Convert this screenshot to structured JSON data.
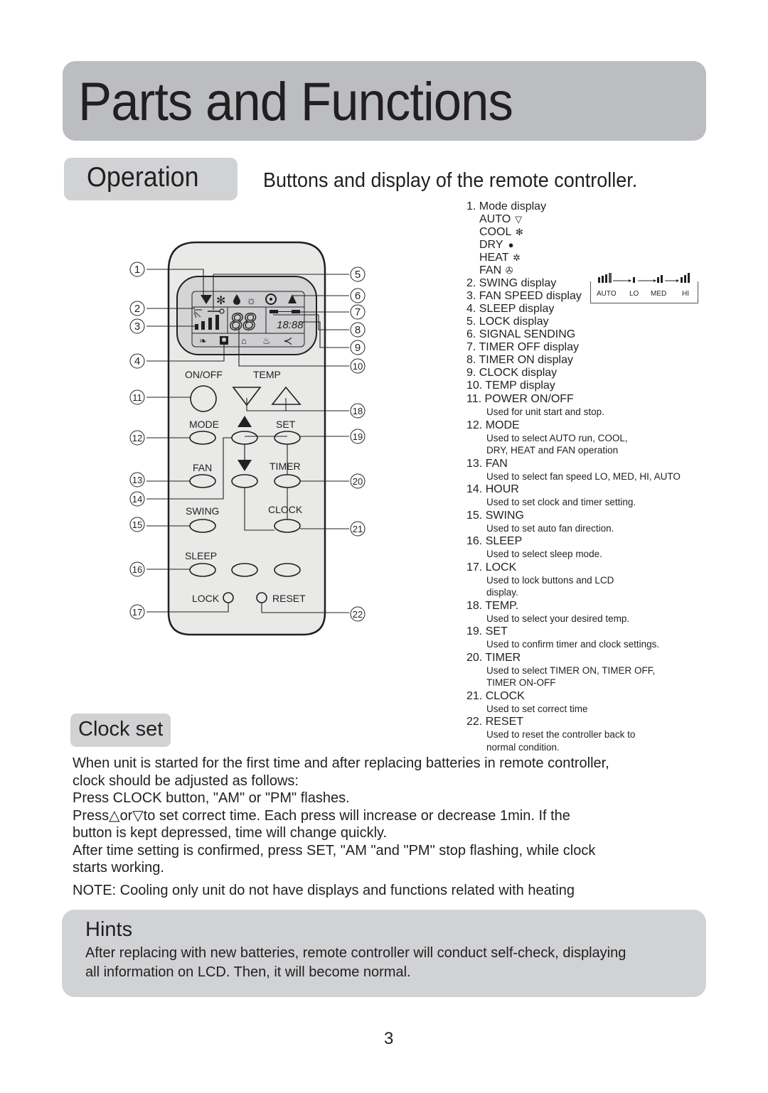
{
  "header": {
    "title": "Parts and Functions"
  },
  "operation": {
    "label": "Operation",
    "subtitle": "Buttons and display of the remote controller."
  },
  "remote": {
    "labels": {
      "onoff": "ON/OFF",
      "temp": "TEMP",
      "mode": "MODE",
      "set": "SET",
      "fan": "FAN",
      "timer": "TIMER",
      "swing": "SWING",
      "clock": "CLOCK",
      "sleep": "SLEEP",
      "lock": "LOCK",
      "reset": "RESET"
    },
    "lcd": {
      "temp_digits": "88",
      "clock_digits": "18:88"
    },
    "callouts": {
      "c1": "1",
      "c2": "2",
      "c3": "3",
      "c4": "4",
      "c5": "5",
      "c6": "6",
      "c7": "7",
      "c8": "8",
      "c9": "9",
      "c10": "10",
      "c11": "11",
      "c12": "12",
      "c13": "13",
      "c14": "14",
      "c15": "15",
      "c16": "16",
      "c17": "17",
      "c18": "18",
      "c19": "19",
      "c20": "20",
      "c21": "21",
      "c22": "22"
    }
  },
  "legend": {
    "mode_display": "1. Mode display",
    "modes": [
      {
        "label": "AUTO",
        "icon": "auto-icon",
        "glyph": "▽"
      },
      {
        "label": "COOL",
        "icon": "snowflake-icon",
        "glyph": "✻"
      },
      {
        "label": "DRY",
        "icon": "droplet-icon",
        "glyph": "●"
      },
      {
        "label": "HEAT",
        "icon": "sun-icon",
        "glyph": "✲"
      },
      {
        "label": "FAN",
        "icon": "fan-icon",
        "glyph": "✇"
      }
    ],
    "fan_speed_levels": [
      "AUTO",
      "LO",
      "MED",
      "HI"
    ],
    "items": [
      {
        "title": "2. SWING display"
      },
      {
        "title": "3. FAN SPEED display"
      },
      {
        "title": "4. SLEEP display"
      },
      {
        "title": "5. LOCK display"
      },
      {
        "title": "6. SIGNAL SENDING"
      },
      {
        "title": "7. TIMER OFF display"
      },
      {
        "title": "8. TIMER ON display"
      },
      {
        "title": "9. CLOCK display"
      },
      {
        "title": "10. TEMP display"
      },
      {
        "title": "11. POWER ON/OFF",
        "desc": [
          "Used for unit start and stop."
        ]
      },
      {
        "title": "12. MODE",
        "desc": [
          "Used to select AUTO run, COOL,",
          "DRY, HEAT and FAN operation"
        ]
      },
      {
        "title": "13. FAN",
        "desc": [
          "Used to select fan speed LO, MED, HI,  AUTO"
        ]
      },
      {
        "title": "14. HOUR",
        "desc": [
          "Used to set clock and timer setting."
        ]
      },
      {
        "title": "15. SWING",
        "desc": [
          "Used to set auto fan direction."
        ]
      },
      {
        "title": "16. SLEEP",
        "desc": [
          "Used to select sleep mode."
        ]
      },
      {
        "title": "17. LOCK",
        "desc": [
          "Used to lock buttons and LCD",
          "display."
        ]
      },
      {
        "title": "18. TEMP.",
        "desc": [
          "Used to select your desired temp."
        ]
      },
      {
        "title": "19. SET",
        "desc": [
          "Used to confirm timer and clock settings."
        ]
      },
      {
        "title": "20. TIMER",
        "desc": [
          "Used to select TIMER ON, TIMER OFF,",
          "TIMER ON-OFF"
        ]
      },
      {
        "title": "21. CLOCK",
        "desc": [
          "Used to set correct time"
        ]
      },
      {
        "title": "22. RESET",
        "desc": [
          "Used to reset  the controller back to",
          "normal condition."
        ]
      }
    ]
  },
  "clock_set": {
    "label": "Clock set",
    "lines": [
      "When unit is started for the first time and after replacing batteries in remote controller,",
      "clock should be adjusted as follows:",
      "Press CLOCK button, \"AM\" or \"PM\" flashes.",
      "Press△or▽to set correct time. Each press will increase or decrease 1min. If the",
      "button is kept depressed, time will change quickly.",
      "After time setting is confirmed, press SET, \"AM \"and \"PM\" stop flashing, while clock",
      "starts working."
    ],
    "note": "NOTE:  Cooling only unit do not have  displays and functions related with heating"
  },
  "hints": {
    "title": "Hints",
    "lines": [
      "After replacing with new batteries, remote controller will conduct self-check, displaying",
      "all information on LCD. Then, it will become normal."
    ]
  },
  "page_number": "3"
}
